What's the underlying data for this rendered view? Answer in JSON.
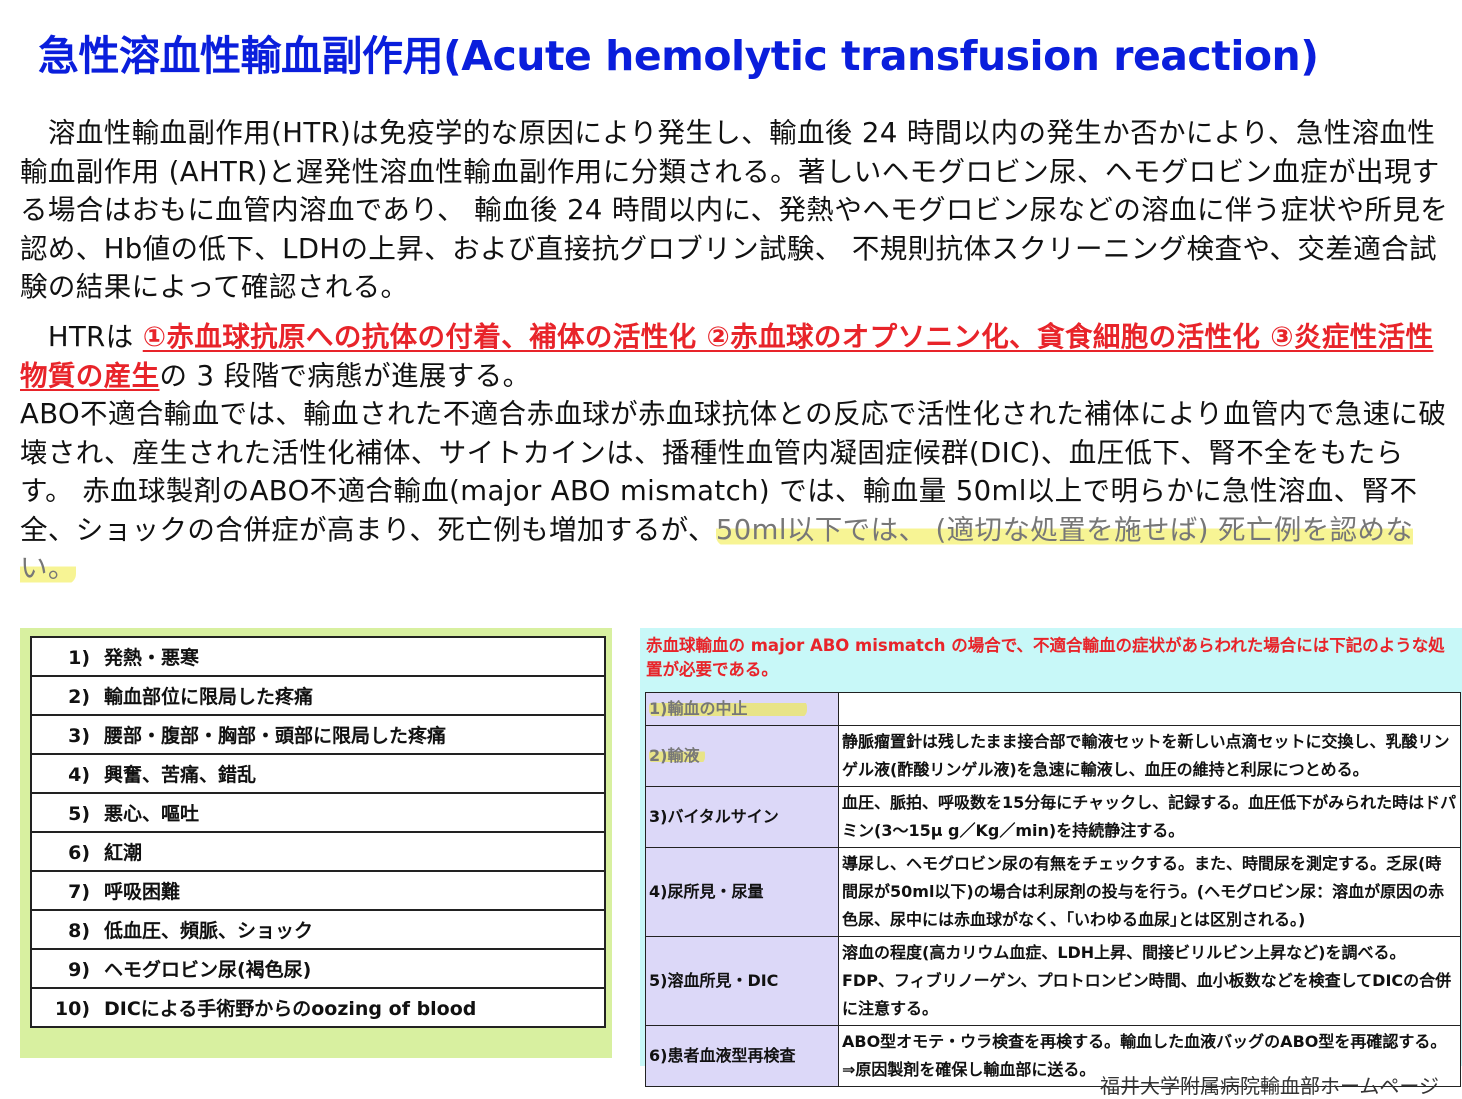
{
  "title": "急性溶血性輸血副作用(Acute hemolytic transfusion reaction)",
  "paragraph1": "溶血性輸血副作用(HTR)は免疫学的な原因により発生し、輸血後 24 時間以内の発生か否かにより、急性溶血性輸血副作用 (AHTR)と遅発性溶血性輸血副作用に分類される。著しいヘモグロビン尿、ヘモグロビン血症が出現する場合はおもに血管内溶血であり、 輸血後 24 時間以内に、発熱やヘモグロビン尿などの溶血に伴う症状や所見を認め、Hb値の低下、LDHの上昇、および直接抗グロブリン試験、 不規則抗体スクリーニング検査や、交差適合試験の結果によって確認される。",
  "paragraph2": {
    "lead": "HTRは ",
    "stages": "①赤血球抗原への抗体の付着、補体の活性化 ②赤血球のオプソニン化、貪食細胞の活性化 ③炎症性活性物質の産生",
    "stages_tail": "の 3 段階で病態が進展する。",
    "body": "ABO不適合輸血では、輸血された不適合赤血球が赤血球抗体との反応で活性化された補体により血管内で急速に破壊され、産生された活性化補体、サイトカインは、播種性血管内凝固症候群(DIC)、血圧低下、腎不全をもたらす。 赤血球製剤のABO不適合輸血(major ABO mismatch) では、輸血量 50ml以上で明らかに急性溶血、腎不全、ショックの合併症が高まり、死亡例も増加するが、",
    "highlight": "50ml以下では、 (適切な処置を施せば) 死亡例を認めない。"
  },
  "symptoms": [
    {
      "num": "1)",
      "text": "発熱・悪寒"
    },
    {
      "num": "2)",
      "text": "輸血部位に限局した疼痛"
    },
    {
      "num": "3)",
      "text": "腰部・腹部・胸部・頭部に限局した疼痛"
    },
    {
      "num": "4)",
      "text": "興奮、苦痛、錯乱"
    },
    {
      "num": "5)",
      "text": "悪心、嘔吐"
    },
    {
      "num": "6)",
      "text": "紅潮"
    },
    {
      "num": "7)",
      "text": "呼吸困難"
    },
    {
      "num": "8)",
      "text": "低血圧、頻脈、ショック"
    },
    {
      "num": "9)",
      "text": "ヘモグロビン尿(褐色尿)"
    },
    {
      "num": "10)",
      "text": "DICによる手術野からのoozing of blood"
    }
  ],
  "treatment_note": "赤血球輸血の major ABO mismatch の場合で、不適合輸血の症状があらわれた場合には下記のような処置が必要である。",
  "treatments": [
    {
      "label": "1)輸血の中止",
      "text": ""
    },
    {
      "label": "2)輸液",
      "text": "静脈瘤置針は残したまま接合部で輸液セットを新しい点滴セットに交換し、乳酸リンゲル液(酢酸リンゲル液)を急速に輸液し、血圧の維持と利尿につとめる。"
    },
    {
      "label": "3)バイタルサイン",
      "text": "血圧、脈拍、呼吸数を15分毎にチャックし、記録する。血圧低下がみられた時はドパミン(3～15μ g／Kg／min)を持続静注する。"
    },
    {
      "label": "4)尿所見・尿量",
      "text": "導尿し、ヘモグロビン尿の有無をチェックする。また、時間尿を測定する。乏尿(時間尿が50ml以下)の場合は利尿剤の投与を行う。(ヘモグロビン尿：溶血が原因の赤色尿、尿中には赤血球がなく、｢いわゆる血尿｣とは区別される。)"
    },
    {
      "label": "5)溶血所見・DIC",
      "text": "溶血の程度(高カリウム血症、LDH上昇、間接ビリルビン上昇など)を調べる。FDP、フィブリノーゲン、プロトロンビン時間、血小板数などを検査してDICの合併に注意する。"
    },
    {
      "label": "6)患者血液型再検査",
      "text": "ABO型オモテ・ウラ検査を再検する。輸血した血液バッグのABO型を再確認する。⇒原因製剤を確保し輸血部に送る。"
    }
  ],
  "footer": "福井大学附属病院輸血部ホームページ"
}
